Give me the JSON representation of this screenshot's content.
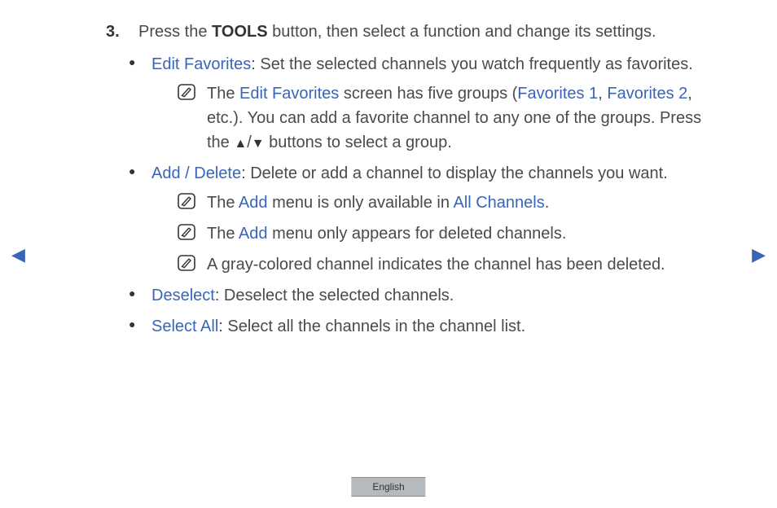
{
  "step": {
    "number": "3.",
    "text_before": " Press the ",
    "tools": "TOOLS",
    "text_after": " button, then select a function and change its settings."
  },
  "items": {
    "edit_fav": {
      "label": "Edit Favorites",
      "desc": ": Set the selected channels you watch frequently as favorites.",
      "note1_a": "The ",
      "note1_link1": "Edit Favorites",
      "note1_b": " screen has five groups (",
      "note1_link2": "Favorites 1",
      "note1_c": ", ",
      "note1_link3": "Favorites 2",
      "note1_d": ", etc.). You can add a favorite channel to any one of the groups. Press the ",
      "note1_tri_up": "▲",
      "note1_slash": "/",
      "note1_tri_down": "▼",
      "note1_e": " buttons to select a group."
    },
    "add_del": {
      "label": "Add / Delete",
      "desc": ": Delete or add a channel to display the channels you want.",
      "note1_a": "The ",
      "note1_link1": "Add",
      "note1_b": " menu is only available in ",
      "note1_link2": "All Channels",
      "note1_c": ".",
      "note2_a": "The ",
      "note2_link1": "Add",
      "note2_b": " menu only appears for deleted channels.",
      "note3": "A gray-colored channel indicates the channel has been deleted."
    },
    "deselect": {
      "label": "Deselect",
      "desc": ": Deselect the selected channels."
    },
    "select_all": {
      "label": "Select All",
      "desc": ": Select all the channels in the channel list."
    }
  },
  "nav": {
    "prev": "◀",
    "next": "▶"
  },
  "footer": {
    "lang": "English"
  }
}
